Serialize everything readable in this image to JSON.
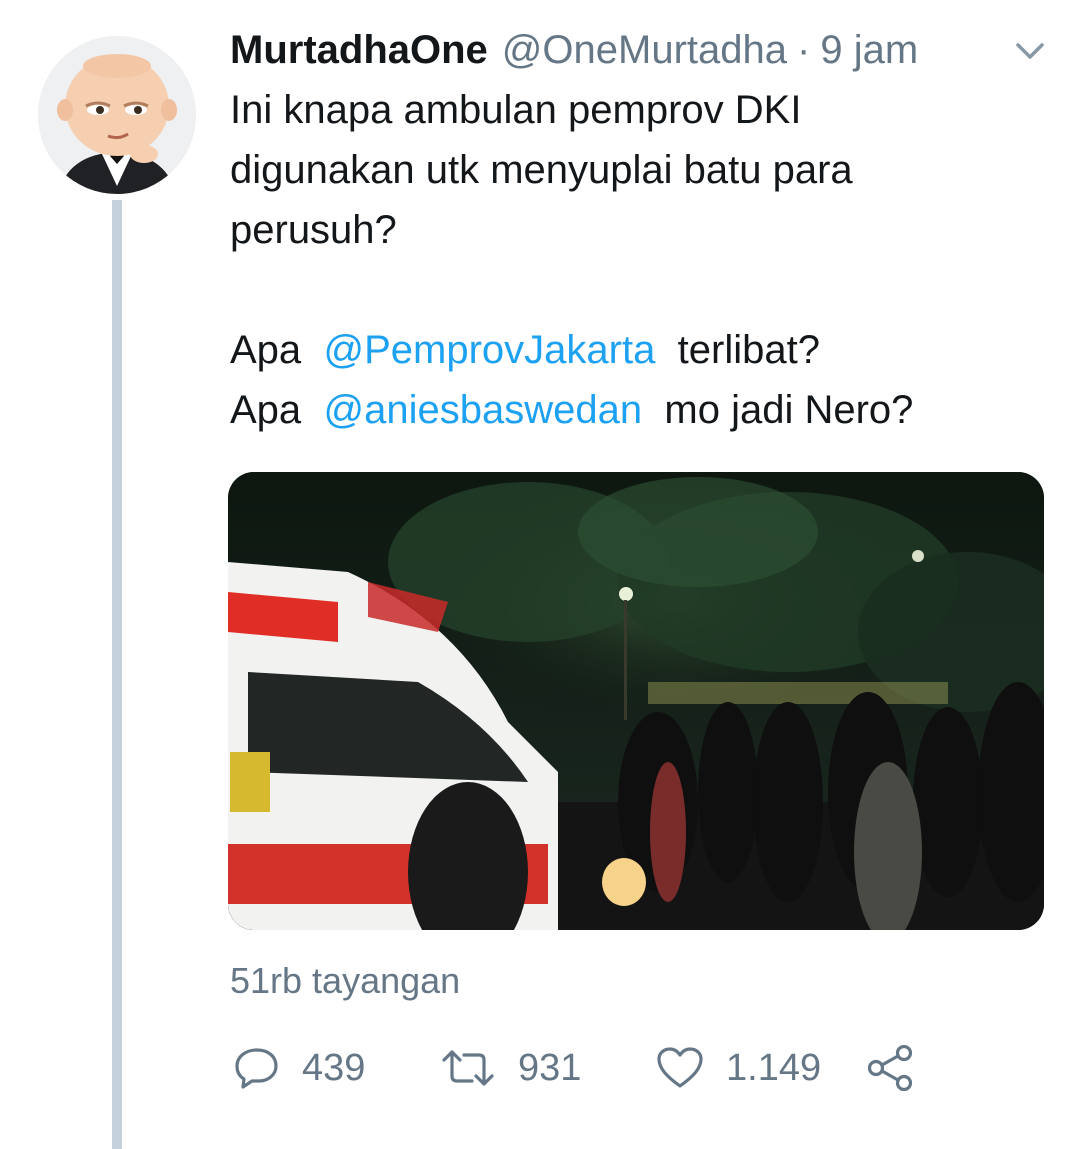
{
  "tweet": {
    "author_name": "MurtadhaOne",
    "author_handle": "@OneMurtadha",
    "separator": "·",
    "time": "9 jam",
    "text_line_1": "Ini knapa ambulan pemprov DKI",
    "text_line_2": "digunakan utk menyuplai batu para",
    "text_line_3": "perusuh?",
    "line_4_prefix": "Apa",
    "mention_1": "@PemprovJakarta",
    "line_4_suffix": "terlibat?",
    "line_5_prefix": "Apa",
    "mention_2": "@aniesbaswedan",
    "line_5_suffix": "mo jadi Nero?",
    "views": "51rb tayangan"
  },
  "actions": {
    "reply_count": "439",
    "retweet_count": "931",
    "like_count": "1.149"
  },
  "icons": {
    "options": "chevron-down-icon",
    "reply": "reply-icon",
    "retweet": "retweet-icon",
    "like": "heart-icon",
    "share": "share-icon"
  },
  "colors": {
    "text": "#14171a",
    "secondary": "#657786",
    "link": "#1da1f2",
    "thread_line": "#c5d1db"
  }
}
